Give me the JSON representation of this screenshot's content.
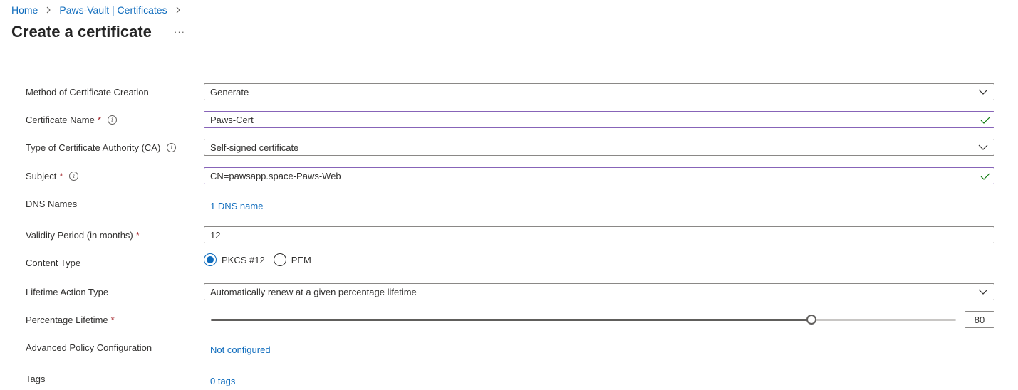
{
  "breadcrumb": {
    "home": "Home",
    "vault": "Paws-Vault | Certificates"
  },
  "page": {
    "title": "Create a certificate",
    "more": "···"
  },
  "form": {
    "method": {
      "label": "Method of Certificate Creation",
      "value": "Generate"
    },
    "name": {
      "label": "Certificate Name",
      "required": "*",
      "value": "Paws-Cert"
    },
    "ca_type": {
      "label": "Type of Certificate Authority (CA)",
      "value": "Self-signed certificate"
    },
    "subject": {
      "label": "Subject",
      "required": "*",
      "value": "CN=pawsapp.space-Paws-Web"
    },
    "dns": {
      "label": "DNS Names",
      "link": "1 DNS name"
    },
    "validity": {
      "label": "Validity Period (in months)",
      "required": "*",
      "value": "12"
    },
    "content_type": {
      "label": "Content Type",
      "options": [
        "PKCS #12",
        "PEM"
      ],
      "selected": "PKCS #12"
    },
    "lifetime_action": {
      "label": "Lifetime Action Type",
      "value": "Automatically renew at a given percentage lifetime"
    },
    "percentage": {
      "label": "Percentage Lifetime",
      "required": "*",
      "value": "80",
      "fraction": 0.806
    },
    "advanced": {
      "label": "Advanced Policy Configuration",
      "link": "Not configured"
    },
    "tags": {
      "label": "Tags",
      "link": "0 tags"
    }
  },
  "colors": {
    "accent": "#0f6cbd",
    "valid_border": "#8764b8",
    "check": "#107c10",
    "required": "#a4262c"
  },
  "icons": {
    "dropdown": "chevron-down-icon",
    "valid": "checkmark-icon",
    "info": "info-icon"
  }
}
